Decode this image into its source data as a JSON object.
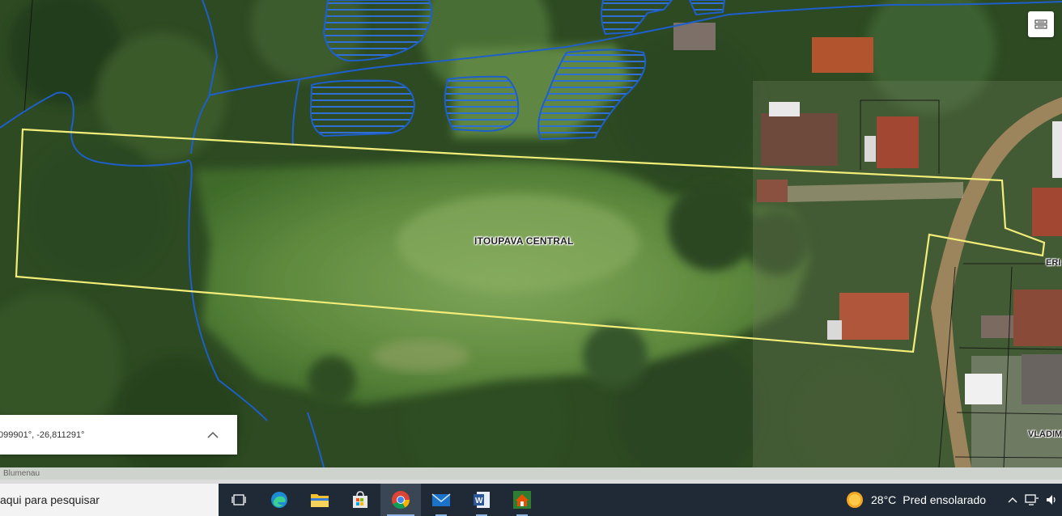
{
  "map": {
    "parcel_label": "ITOUPAVA CENTRAL",
    "street_labels": [
      "ERI",
      "VLADIM"
    ],
    "coordinates": "099901°, -26,811291°",
    "attribution": "Blumenau",
    "colors": {
      "parcel_outline": "#f3ee7a",
      "hydro_lines": "#1e5fc9",
      "hatch_fill": "#2f6fd6"
    }
  },
  "controls": {
    "basemap_icon": "basemap-toggle-icon",
    "expand_icon": "chevron-up-icon"
  },
  "taskbar": {
    "search_text": "aqui para pesquisar",
    "apps": [
      {
        "name": "task-view-icon"
      },
      {
        "name": "edge-icon"
      },
      {
        "name": "file-explorer-icon"
      },
      {
        "name": "store-icon"
      },
      {
        "name": "chrome-icon"
      },
      {
        "name": "mail-icon"
      },
      {
        "name": "word-icon"
      },
      {
        "name": "house-app-icon"
      }
    ],
    "weather_temp": "28°C",
    "weather_desc": "Pred ensolarado",
    "tray_icons": [
      "chevron-up-icon",
      "network-icon",
      "volume-icon"
    ]
  }
}
